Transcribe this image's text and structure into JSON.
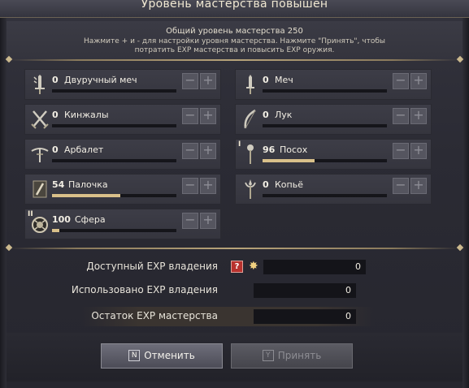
{
  "dialog": {
    "title": "Уровень мастерства повышен",
    "total_level": "Общий уровень мастерства 250",
    "instructions": "Нажмите + и - для настройки уровня мастерства. Нажмите \"Принять\", чтобы потратить EXP мастерства и повысить EXP оружия."
  },
  "weapons": [
    {
      "level": "0",
      "name": "Двуручный меч",
      "progress": 0,
      "icon": "two-handed-sword-icon"
    },
    {
      "level": "0",
      "name": "Меч",
      "progress": 0,
      "icon": "sword-icon"
    },
    {
      "level": "0",
      "name": "Кинжалы",
      "progress": 0,
      "icon": "daggers-icon"
    },
    {
      "level": "0",
      "name": "Лук",
      "progress": 0,
      "icon": "bow-icon"
    },
    {
      "level": "0",
      "name": "Арбалет",
      "progress": 0,
      "icon": "crossbow-icon"
    },
    {
      "level": "96",
      "name": "Посох",
      "progress": 0.42,
      "icon": "staff-icon",
      "rank": "I"
    },
    {
      "level": "54",
      "name": "Палочка",
      "progress": 0.55,
      "icon": "wand-icon"
    },
    {
      "level": "0",
      "name": "Копьё",
      "progress": 0,
      "icon": "spear-icon"
    },
    {
      "level": "100",
      "name": "Сфера",
      "progress": 0.06,
      "icon": "orb-icon",
      "rank": "II"
    }
  ],
  "buttons": {
    "minus": "−",
    "plus": "+"
  },
  "exp": {
    "available_label": "Доступный EXP владения",
    "available_value": "0",
    "used_label": "Использовано EXP владения",
    "used_value": "0",
    "remaining_label": "Остаток EXP мастерства",
    "remaining_value": "0",
    "help": "?"
  },
  "footer": {
    "cancel_key": "N",
    "cancel_label": "Отменить",
    "accept_key": "Y",
    "accept_label": "Принять"
  }
}
